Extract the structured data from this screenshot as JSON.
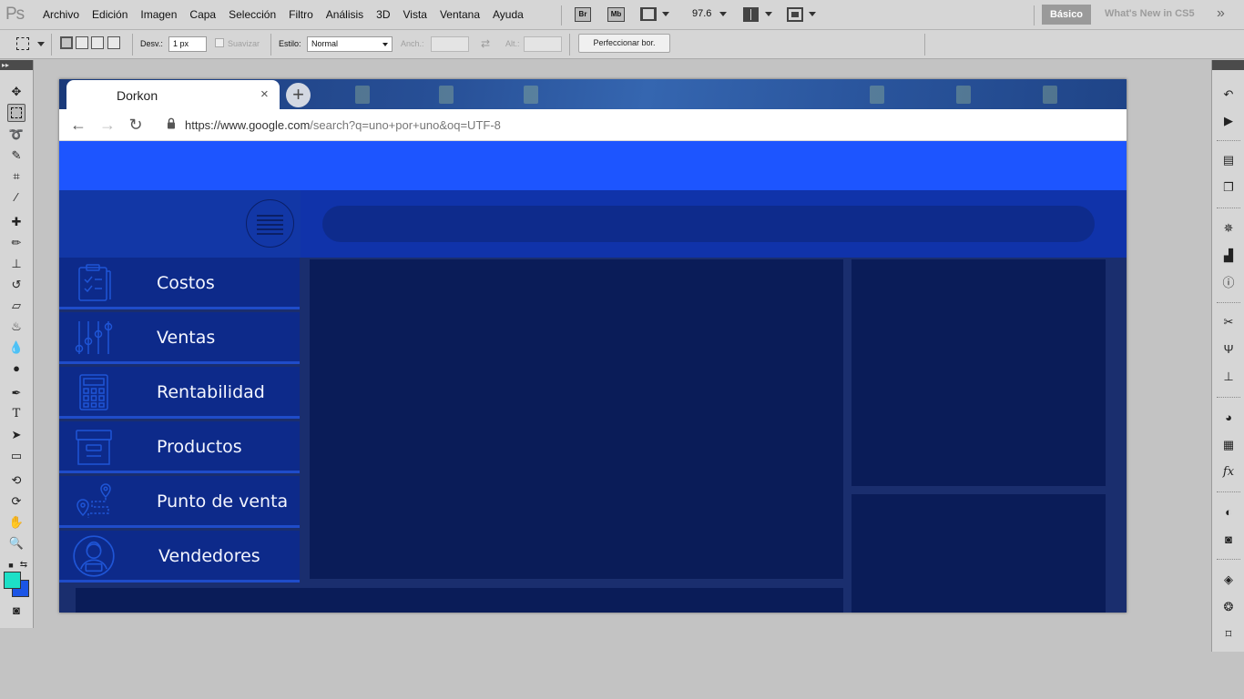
{
  "photoshop": {
    "logo": "Ps",
    "menus": [
      "Archivo",
      "Edición",
      "Imagen",
      "Capa",
      "Selección",
      "Filtro",
      "Análisis",
      "3D",
      "Vista",
      "Ventana",
      "Ayuda"
    ],
    "bridge_label": "Br",
    "minibridge_label": "Mb",
    "zoom": "97.6",
    "workspace": "Básico",
    "whats_new": "What's New in CS5",
    "more": "»"
  },
  "options": {
    "feather_label": "Desv.:",
    "feather_value": "1 px",
    "antialias_label": "Suavizar",
    "style_label": "Estilo:",
    "style_value": "Normal",
    "width_label": "Anch.:",
    "height_label": "Alt.:",
    "refine_label": "Perfeccionar bor."
  },
  "colors": {
    "foreground": "#1de0c7",
    "background": "#1b55e6"
  },
  "browser": {
    "tab_title": "Dorkon",
    "close_symbol": "×",
    "new_tab_symbol": "+",
    "url_host": "https://www.google.com",
    "url_rest": "/search?q=uno+por+uno&oq=UTF-8"
  },
  "app": {
    "accent": "#1d55ff",
    "sidebar": [
      {
        "label": "Costos",
        "icon": "clipboard-icon"
      },
      {
        "label": "Ventas",
        "icon": "sliders-icon"
      },
      {
        "label": "Rentabilidad",
        "icon": "calculator-icon"
      },
      {
        "label": "Productos",
        "icon": "archive-box-icon"
      },
      {
        "label": "Punto de venta",
        "icon": "location-pin-icon"
      },
      {
        "label": "Vendedores",
        "icon": "user-avatar-icon"
      }
    ]
  }
}
